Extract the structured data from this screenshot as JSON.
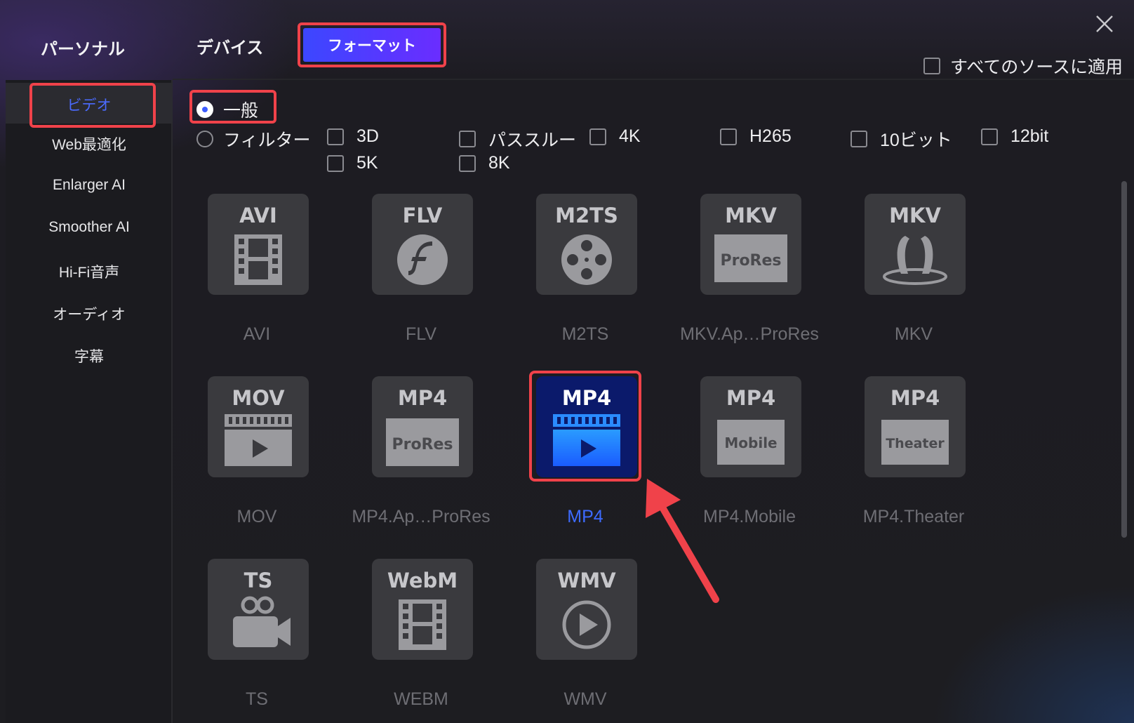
{
  "tabs": {
    "personal": "パーソナル",
    "device": "デバイス",
    "format": "フォーマット",
    "active": "format"
  },
  "apply_all": {
    "label": "すべてのソースに適用",
    "checked": false
  },
  "sidebar": {
    "items": [
      {
        "label": "ビデオ",
        "active": true
      },
      {
        "label": "Web最適化"
      },
      {
        "label": "Enlarger AI"
      },
      {
        "label": "Smoother AI"
      },
      {
        "label": "Hi-Fi音声"
      },
      {
        "label": "オーディオ"
      },
      {
        "label": "字幕"
      }
    ]
  },
  "mode": {
    "general": {
      "label": "一般",
      "selected": true
    },
    "filter": {
      "label": "フィルター",
      "selected": false
    }
  },
  "filters": [
    {
      "label": "3D",
      "checked": false
    },
    {
      "label": "パススルー",
      "checked": false
    },
    {
      "label": "4K",
      "checked": false
    },
    {
      "label": "H265",
      "checked": false
    },
    {
      "label": "10ビット",
      "checked": false
    },
    {
      "label": "12bit",
      "checked": false
    },
    {
      "label": "5K",
      "checked": false
    },
    {
      "label": "8K",
      "checked": false
    }
  ],
  "formats": [
    {
      "title": "AVI",
      "art": "film-strip",
      "label": "AVI"
    },
    {
      "title": "FLV",
      "art": "flash",
      "label": "FLV"
    },
    {
      "title": "M2TS",
      "art": "reel",
      "label": "M2TS"
    },
    {
      "title": "MKV",
      "art": "prores",
      "art_text": "ProRes",
      "label": "MKV.Ap…ProRes"
    },
    {
      "title": "MKV",
      "art": "matroska",
      "label": "MKV"
    },
    {
      "title": "MOV",
      "art": "clapper",
      "label": "MOV"
    },
    {
      "title": "MP4",
      "art": "prores",
      "art_text": "ProRes",
      "label": "MP4.Ap…ProRes"
    },
    {
      "title": "MP4",
      "art": "clapper-blue",
      "label": "MP4",
      "selected": true
    },
    {
      "title": "MP4",
      "art": "box",
      "art_text": "Mobile",
      "label": "MP4.Mobile"
    },
    {
      "title": "MP4",
      "art": "box",
      "art_text": "Theater",
      "label": "MP4.Theater"
    },
    {
      "title": "TS",
      "art": "camera",
      "label": "TS"
    },
    {
      "title": "WebM",
      "art": "film-strip",
      "label": "WEBM"
    },
    {
      "title": "WMV",
      "art": "play-circle",
      "label": "WMV"
    }
  ],
  "colors": {
    "accent": "#3d5cff",
    "highlight": "#f0424a",
    "tile": "#3a3a3e"
  }
}
